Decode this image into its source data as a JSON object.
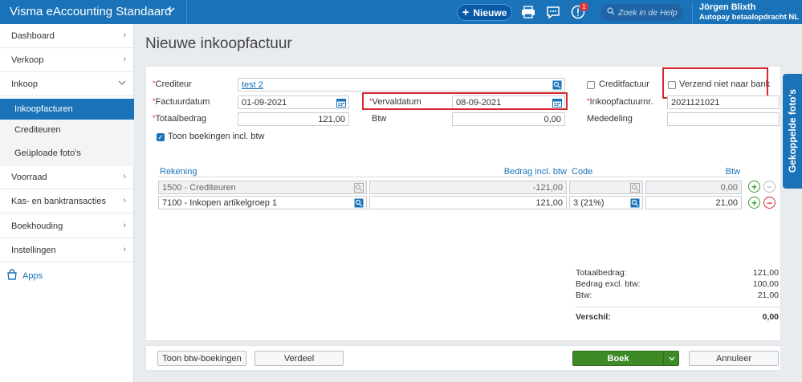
{
  "header": {
    "app_title": "Visma eAccounting Standaard",
    "new_button": "Nieuwe",
    "notification_count": "1",
    "search_placeholder": "Zoek in de Help",
    "user_name": "Jörgen Blixth",
    "user_company": "Autopay betaalopdracht NL",
    "accent_color": "#1a73b8"
  },
  "sidebar": {
    "items": [
      {
        "label": "Dashboard"
      },
      {
        "label": "Verkoop"
      },
      {
        "label": "Inkoop"
      },
      {
        "label": "Voorraad"
      },
      {
        "label": "Kas- en banktransacties"
      },
      {
        "label": "Boekhouding"
      },
      {
        "label": "Instellingen"
      }
    ],
    "sub_items": [
      {
        "label": "Inkoopfacturen",
        "active": true
      },
      {
        "label": "Crediteuren"
      },
      {
        "label": "Geüploade foto's"
      }
    ],
    "apps_label": "Apps"
  },
  "page": {
    "title": "Nieuwe inkoopfactuur"
  },
  "form": {
    "crediteur_label": "Crediteur",
    "crediteur_value": "test 2",
    "factuurdatum_label": "Factuurdatum",
    "factuurdatum_value": "01-09-2021",
    "vervaldatum_label": "Vervaldatum",
    "vervaldatum_value": "08-09-2021",
    "totaalbedrag_label": "Totaalbedrag",
    "totaalbedrag_value": "121,00",
    "btw_label": "Btw",
    "btw_value": "0,00",
    "creditfactuur_label": "Creditfactuur",
    "verzend_label": "Verzend niet naar bank",
    "inkoopfactuurnr_label": "Inkoopfactuurnr.",
    "inkoopfactuurnr_value": "2021121021",
    "mededeling_label": "Mededeling",
    "mededeling_value": "",
    "toon_boekingen_label": "Toon boekingen incl. btw"
  },
  "table": {
    "headers": {
      "rekening": "Rekening",
      "bedrag": "Bedrag incl. btw",
      "code": "Code",
      "btw": "Btw"
    },
    "rows": [
      {
        "rekening": "1500 - Crediteuren",
        "bedrag": "-121,00",
        "code": "",
        "btw": "0,00"
      },
      {
        "rekening": "7100 - Inkopen artikelgroep 1",
        "bedrag": "121,00",
        "code": "3 (21%)",
        "btw": "21,00"
      }
    ]
  },
  "totals": {
    "totaalbedrag_label": "Totaalbedrag:",
    "totaalbedrag_value": "121,00",
    "excl_label": "Bedrag excl. btw:",
    "excl_value": "100,00",
    "btw_label": "Btw:",
    "btw_value": "21,00",
    "verschil_label": "Verschil:",
    "verschil_value": "0,00"
  },
  "footer": {
    "toon_btw_button": "Toon btw-boekingen",
    "verdeel_button": "Verdeel",
    "boek_button": "Boek",
    "annuleer_button": "Annuleer"
  },
  "side_tab": {
    "label": "Gekoppelde foto's"
  }
}
